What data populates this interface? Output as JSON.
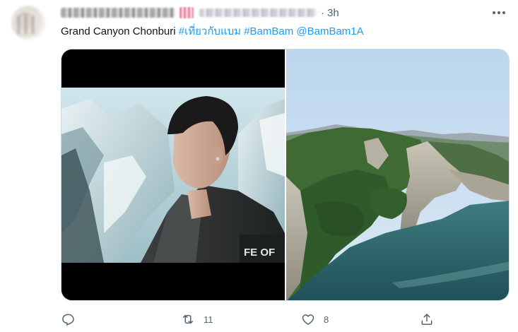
{
  "tweet": {
    "dot": "·",
    "time": "3h",
    "text_plain": "Grand Canyon Chonburi ",
    "hashtag_1": "#เที่ยวกับแบม",
    "hashtag_2": "#BamBam",
    "mention": "@BamBam1A",
    "media": [
      {
        "kind": "photo",
        "subject": "man-on-snowy-mountain",
        "overlay_text": "FE OF"
      },
      {
        "kind": "photo",
        "subject": "grand-canyon-chonburi-lake"
      }
    ]
  },
  "actions": {
    "reply": {
      "icon": "reply-icon",
      "count": ""
    },
    "retweet": {
      "icon": "retweet-icon",
      "count": "11"
    },
    "like": {
      "icon": "heart-icon",
      "count": "8"
    },
    "share": {
      "icon": "share-icon",
      "count": ""
    }
  },
  "colors": {
    "link": "#1d9bf0",
    "secondary_text": "#536471",
    "border": "#cfd9de"
  }
}
